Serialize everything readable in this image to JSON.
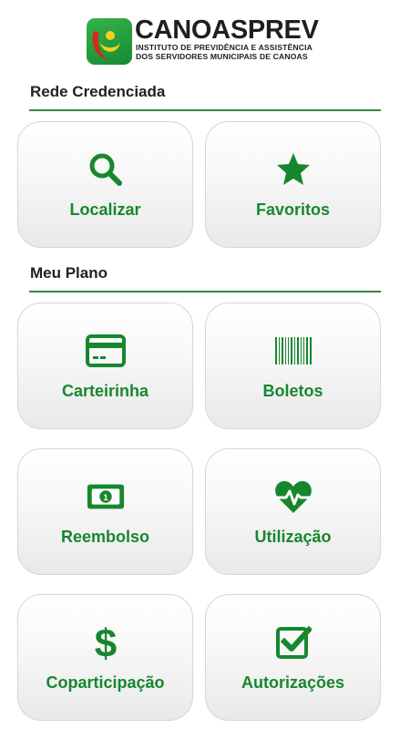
{
  "header": {
    "title": "CANOASPREV",
    "subtitle_line1": "INSTITUTO DE PREVIDÊNCIA E ASSISTÊNCIA",
    "subtitle_line2": "DOS SERVIDORES MUNICIPAIS DE CANOAS"
  },
  "sections": {
    "rede": {
      "title": "Rede Credenciada",
      "items": [
        {
          "label": "Localizar",
          "icon": "search-icon"
        },
        {
          "label": "Favoritos",
          "icon": "star-icon"
        }
      ]
    },
    "plano": {
      "title": "Meu Plano",
      "items": [
        {
          "label": "Carteirinha",
          "icon": "card-icon"
        },
        {
          "label": "Boletos",
          "icon": "barcode-icon"
        },
        {
          "label": "Reembolso",
          "icon": "money-icon"
        },
        {
          "label": "Utilização",
          "icon": "heartbeat-icon"
        },
        {
          "label": "Coparticipação",
          "icon": "dollar-icon"
        },
        {
          "label": "Autorizações",
          "icon": "checkbox-icon"
        }
      ]
    }
  },
  "colors": {
    "accent": "#17872e",
    "rule": "#2e8b3e",
    "logo_green": "#1f9a3c",
    "logo_red": "#d42a1c",
    "logo_yellow": "#f2d11b"
  }
}
